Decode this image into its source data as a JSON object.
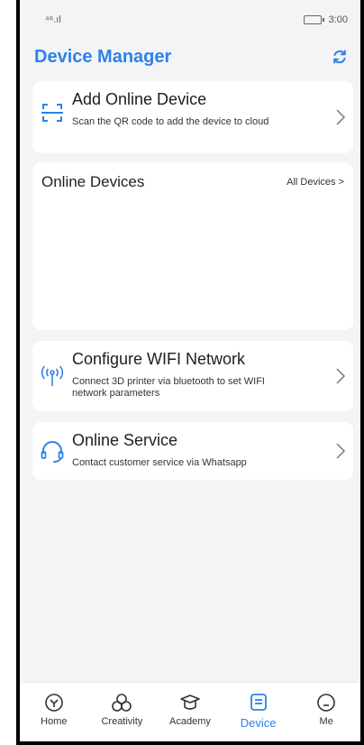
{
  "status_bar": {
    "signal": "⁴⁶.ıl",
    "time": "3:00"
  },
  "header": {
    "title": "Device Manager"
  },
  "add_device": {
    "title": "Add Online Device",
    "subtitle": "Scan the QR code to add the device to cloud"
  },
  "online_devices": {
    "title": "Online Devices",
    "link": "All Devices >"
  },
  "wifi": {
    "title": "Configure WIFI Network",
    "subtitle": "Connect 3D printer via bluetooth to set WIFI network parameters"
  },
  "service": {
    "title": "Online Service",
    "subtitle": "Contact customer service via Whatsapp"
  },
  "tabs": [
    {
      "label": "Home",
      "icon": "home-icon"
    },
    {
      "label": "Creativity",
      "icon": "creativity-icon"
    },
    {
      "label": "Academy",
      "icon": "academy-icon"
    },
    {
      "label": "Device",
      "icon": "device-icon"
    },
    {
      "label": "Me",
      "icon": "me-icon"
    }
  ],
  "active_tab": "Device",
  "colors": {
    "accent": "#2b82ea",
    "background": "#f4f4f6",
    "card": "#ffffff"
  }
}
